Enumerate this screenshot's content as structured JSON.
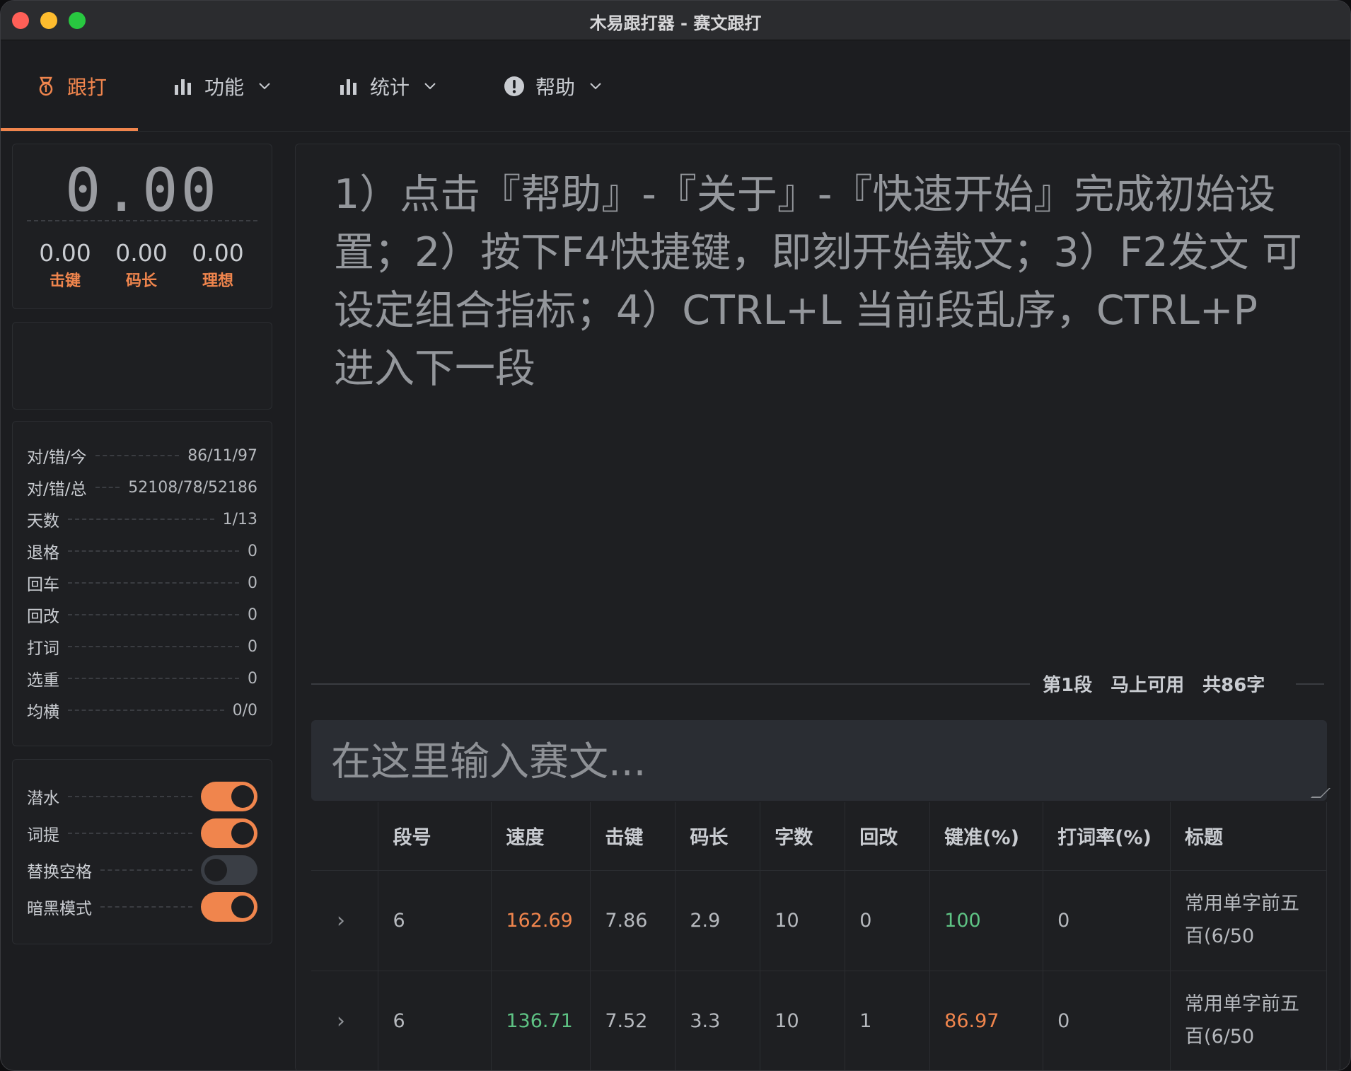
{
  "window": {
    "title": "木易跟打器 - 赛文跟打"
  },
  "nav": {
    "items": [
      {
        "label": "跟打",
        "icon": "medal-icon",
        "active": true
      },
      {
        "label": "功能",
        "icon": "bar-chart-icon",
        "active": false
      },
      {
        "label": "统计",
        "icon": "bar-chart-icon",
        "active": false
      },
      {
        "label": "帮助",
        "icon": "exclamation-circle-icon",
        "active": false
      }
    ]
  },
  "speed_panel": {
    "speed": "0.00",
    "stats": [
      {
        "value": "0.00",
        "label": "击键"
      },
      {
        "value": "0.00",
        "label": "码长"
      },
      {
        "value": "0.00",
        "label": "理想"
      }
    ]
  },
  "stats_panel": {
    "rows": [
      {
        "label": "对/错/今",
        "value": "86/11/97"
      },
      {
        "label": "对/错/总",
        "value": "52108/78/52186"
      },
      {
        "label": "天数",
        "value": "1/13"
      },
      {
        "label": "退格",
        "value": "0"
      },
      {
        "label": "回车",
        "value": "0"
      },
      {
        "label": "回改",
        "value": "0"
      },
      {
        "label": "打词",
        "value": "0"
      },
      {
        "label": "选重",
        "value": "0"
      },
      {
        "label": "均横",
        "value": "0/0"
      }
    ]
  },
  "toggles": [
    {
      "label": "潜水",
      "on": true
    },
    {
      "label": "词提",
      "on": true
    },
    {
      "label": "替换空格",
      "on": false
    },
    {
      "label": "暗黑模式",
      "on": true
    }
  ],
  "article": {
    "text": "1）点击『帮助』-『关于』-『快速开始』完成初始设置；2）按下F4快捷键，即刻开始载文；3）F2发文 可设定组合指标；4）CTRL+L 当前段乱序，CTRL+P 进入下一段",
    "segment": "第1段",
    "status": "马上可用",
    "count": "共86字"
  },
  "input": {
    "placeholder": "在这里输入赛文..."
  },
  "colors": {
    "accent": "#f0854d",
    "good": "#5ec384"
  },
  "table": {
    "headers": [
      "段号",
      "速度",
      "击键",
      "码长",
      "字数",
      "回改",
      "键准(%)",
      "打词率(%)",
      "标题"
    ],
    "rows": [
      {
        "expand": "›",
        "seg": "6",
        "speed": "162.69",
        "keystroke": "7.86",
        "codelen": "2.9",
        "chars": "10",
        "back": "0",
        "accuracy": "100",
        "wordrate": "0",
        "title": "常用单字前五百(6/50",
        "speed_color": "orange",
        "accuracy_color": "green"
      },
      {
        "expand": "›",
        "seg": "6",
        "speed": "136.71",
        "keystroke": "7.52",
        "codelen": "3.3",
        "chars": "10",
        "back": "1",
        "accuracy": "86.97",
        "wordrate": "0",
        "title": "常用单字前五百(6/50",
        "speed_color": "green",
        "accuracy_color": "orange"
      }
    ]
  }
}
